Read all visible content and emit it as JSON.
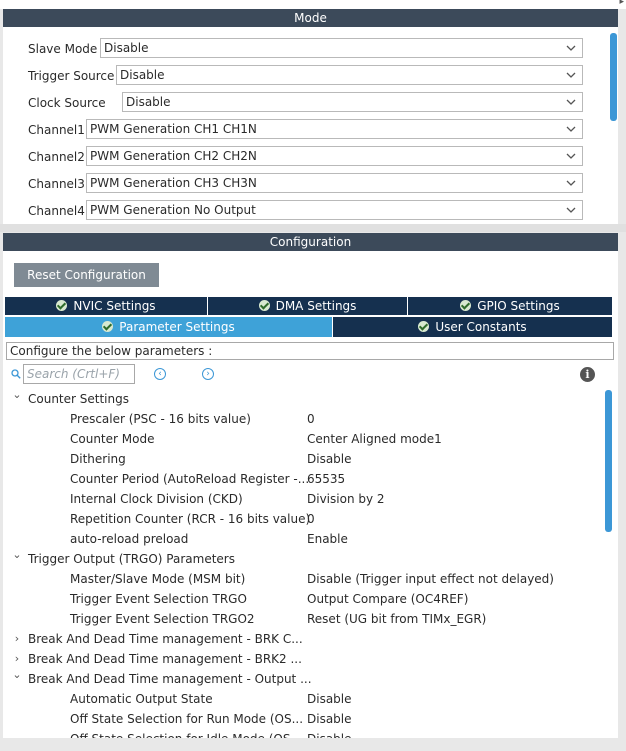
{
  "mode_panel": {
    "title": "Mode",
    "rows": [
      {
        "label": "Slave Mode",
        "value": "Disable"
      },
      {
        "label": "Trigger Source",
        "value": "Disable"
      },
      {
        "label": "Clock Source",
        "value": "Disable"
      },
      {
        "label": "Channel1",
        "value": "PWM Generation CH1 CH1N"
      },
      {
        "label": "Channel2",
        "value": "PWM Generation CH2 CH2N"
      },
      {
        "label": "Channel3",
        "value": "PWM Generation CH3 CH3N"
      },
      {
        "label": "Channel4",
        "value": "PWM Generation No Output"
      }
    ]
  },
  "config_panel": {
    "title": "Configuration",
    "reset_label": "Reset Configuration",
    "tabs_row1": [
      "NVIC Settings",
      "DMA Settings",
      "GPIO Settings"
    ],
    "tabs_row2": [
      "Parameter Settings",
      "User Constants"
    ],
    "active_tab": "Parameter Settings",
    "description": "Configure the below parameters :",
    "search_placeholder": "Search (Crtl+F)",
    "info_glyph": "i",
    "tree": [
      {
        "kind": "group",
        "label": "Counter Settings",
        "expanded": true
      },
      {
        "kind": "param",
        "name": "Prescaler (PSC - 16 bits value)",
        "value": "0"
      },
      {
        "kind": "param",
        "name": "Counter Mode",
        "value": "Center Aligned mode1"
      },
      {
        "kind": "param",
        "name": "Dithering",
        "value": "Disable"
      },
      {
        "kind": "param",
        "name": "Counter Period (AutoReload Register -...",
        "value": "65535"
      },
      {
        "kind": "param",
        "name": "Internal Clock Division (CKD)",
        "value": "Division by 2"
      },
      {
        "kind": "param",
        "name": "Repetition Counter (RCR - 16 bits value)",
        "value": "0"
      },
      {
        "kind": "param",
        "name": "auto-reload preload",
        "value": "Enable"
      },
      {
        "kind": "group",
        "label": "Trigger Output (TRGO) Parameters",
        "expanded": true
      },
      {
        "kind": "param",
        "name": "Master/Slave Mode (MSM bit)",
        "value": "Disable (Trigger input effect not delayed)"
      },
      {
        "kind": "param",
        "name": "Trigger Event Selection TRGO",
        "value": "Output Compare (OC4REF)"
      },
      {
        "kind": "param",
        "name": "Trigger Event Selection TRGO2",
        "value": "Reset (UG bit from TIMx_EGR)"
      },
      {
        "kind": "group",
        "label": "Break And Dead Time management - BRK C...",
        "expanded": false
      },
      {
        "kind": "group",
        "label": "Break And Dead Time management - BRK2 ...",
        "expanded": false
      },
      {
        "kind": "group",
        "label": "Break And Dead Time management - Output ...",
        "expanded": true
      },
      {
        "kind": "param",
        "name": "Automatic Output State",
        "value": "Disable"
      },
      {
        "kind": "param",
        "name": "Off State Selection for Run Mode (OS...",
        "value": "Disable"
      },
      {
        "kind": "param",
        "name": "Off State Selection for Idle Mode (OS...",
        "value": "Disable"
      }
    ]
  },
  "colors": {
    "header_bg": "#3c4a5a",
    "tab_bg": "#15304f",
    "tab_active_bg": "#3ea2d8",
    "scrollbar": "#3c97d6",
    "reset_button_bg": "#7f8a94"
  }
}
